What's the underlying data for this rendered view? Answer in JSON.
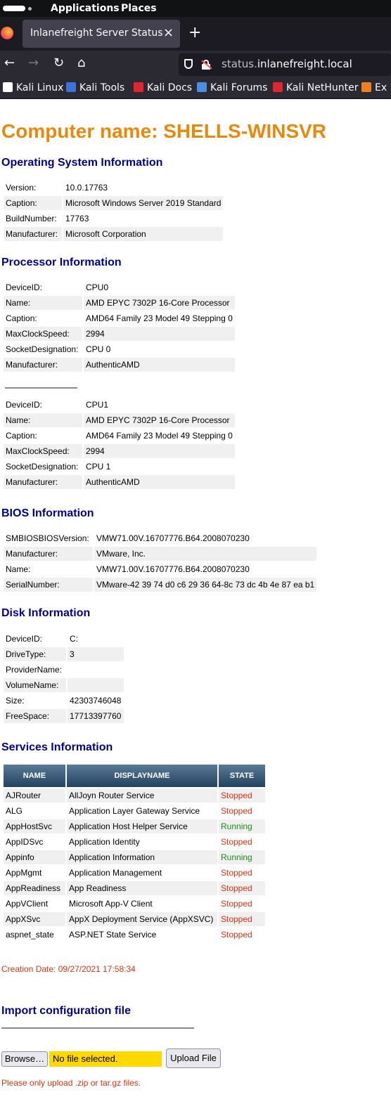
{
  "system_bar": {
    "applications": "Applications",
    "places": "Places"
  },
  "browser": {
    "tab_title": "Inlanefreight Server Status",
    "tab_close": "×",
    "new_tab": "+",
    "url_prefix": "status.",
    "url_domain": "inlanefreight.local",
    "bookmarks": [
      {
        "label": "Kali Linux",
        "icon": "kali-dragon-icon",
        "color": "#ffffff"
      },
      {
        "label": "Kali Tools",
        "icon": "kali-tools-icon",
        "color": "#3b73d8"
      },
      {
        "label": "Kali Docs",
        "icon": "kali-docs-icon",
        "color": "#e0262e"
      },
      {
        "label": "Kali Forums",
        "icon": "kali-forums-icon",
        "color": "#4a8fe0"
      },
      {
        "label": "Kali NetHunter",
        "icon": "kali-nethunter-icon",
        "color": "#e0262e"
      },
      {
        "label": "Ex",
        "icon": "exploit-db-icon",
        "color": "#f07f22"
      }
    ]
  },
  "page": {
    "computer_name": "Computer name: SHELLS-WINSVR",
    "os": {
      "title": "Operating System Information",
      "rows": [
        {
          "label": "Version:",
          "value": "10.0.17763"
        },
        {
          "label": "Caption:",
          "value": "Microsoft Windows Server 2019 Standard"
        },
        {
          "label": "BuildNumber:",
          "value": "17763"
        },
        {
          "label": "Manufacturer:",
          "value": "Microsoft Corporation"
        }
      ]
    },
    "processor": {
      "title": "Processor Information",
      "cpus": [
        [
          {
            "label": "DeviceID:",
            "value": "CPU0"
          },
          {
            "label": "Name:",
            "value": "AMD EPYC 7302P 16-Core Processor"
          },
          {
            "label": "Caption:",
            "value": "AMD64 Family 23 Model 49 Stepping 0"
          },
          {
            "label": "MaxClockSpeed:",
            "value": "2994"
          },
          {
            "label": "SocketDesignation:",
            "value": "CPU 0"
          },
          {
            "label": "Manufacturer:",
            "value": "AuthenticAMD"
          }
        ],
        [
          {
            "label": "DeviceID:",
            "value": "CPU1"
          },
          {
            "label": "Name:",
            "value": "AMD EPYC 7302P 16-Core Processor"
          },
          {
            "label": "Caption:",
            "value": "AMD64 Family 23 Model 49 Stepping 0"
          },
          {
            "label": "MaxClockSpeed:",
            "value": "2994"
          },
          {
            "label": "SocketDesignation:",
            "value": "CPU 1"
          },
          {
            "label": "Manufacturer:",
            "value": "AuthenticAMD"
          }
        ]
      ]
    },
    "bios": {
      "title": "BIOS Information",
      "rows": [
        {
          "label": "SMBIOSBIOSVersion:",
          "value": "VMW71.00V.16707776.B64.2008070230"
        },
        {
          "label": "Manufacturer:",
          "value": "VMware, Inc."
        },
        {
          "label": "Name:",
          "value": "VMW71.00V.16707776.B64.2008070230"
        },
        {
          "label": "SerialNumber:",
          "value": "VMware-42 39 74 d0 c6 29 36 64-8c 73 dc 4b 4e 87 ea b1"
        }
      ]
    },
    "disk": {
      "title": "Disk Information",
      "rows": [
        {
          "label": "DeviceID:",
          "value": "C:"
        },
        {
          "label": "DriveType:",
          "value": "3"
        },
        {
          "label": "ProviderName:",
          "value": ""
        },
        {
          "label": "VolumeName:",
          "value": ""
        },
        {
          "label": "Size:",
          "value": "42303746048"
        },
        {
          "label": "FreeSpace:",
          "value": "17713397760"
        }
      ]
    },
    "services": {
      "title": "Services Information",
      "columns": [
        "NAME",
        "DISPLAYNAME",
        "STATE"
      ],
      "rows": [
        {
          "name": "AJRouter",
          "display": "AllJoyn Router Service",
          "state": "Stopped"
        },
        {
          "name": "ALG",
          "display": "Application Layer Gateway Service",
          "state": "Stopped"
        },
        {
          "name": "AppHostSvc",
          "display": "Application Host Helper Service",
          "state": "Running"
        },
        {
          "name": "AppIDSvc",
          "display": "Application Identity",
          "state": "Stopped"
        },
        {
          "name": "Appinfo",
          "display": "Application Information",
          "state": "Running"
        },
        {
          "name": "AppMgmt",
          "display": "Application Management",
          "state": "Stopped"
        },
        {
          "name": "AppReadiness",
          "display": "App Readiness",
          "state": "Stopped"
        },
        {
          "name": "AppVClient",
          "display": "Microsoft App-V Client",
          "state": "Stopped"
        },
        {
          "name": "AppXSvc",
          "display": "AppX Deployment Service (AppXSVC)",
          "state": "Stopped"
        },
        {
          "name": "aspnet_state",
          "display": "ASP.NET State Service",
          "state": "Stopped"
        }
      ]
    },
    "creation_date": "Creation Date: 09/27/2021 17:58:34",
    "import": {
      "title": "Import configuration file",
      "browse_label": "Browse…",
      "file_status": "No file selected.",
      "upload_label": "Upload File",
      "note": "Please only upload .zip or tar.gz files."
    }
  }
}
